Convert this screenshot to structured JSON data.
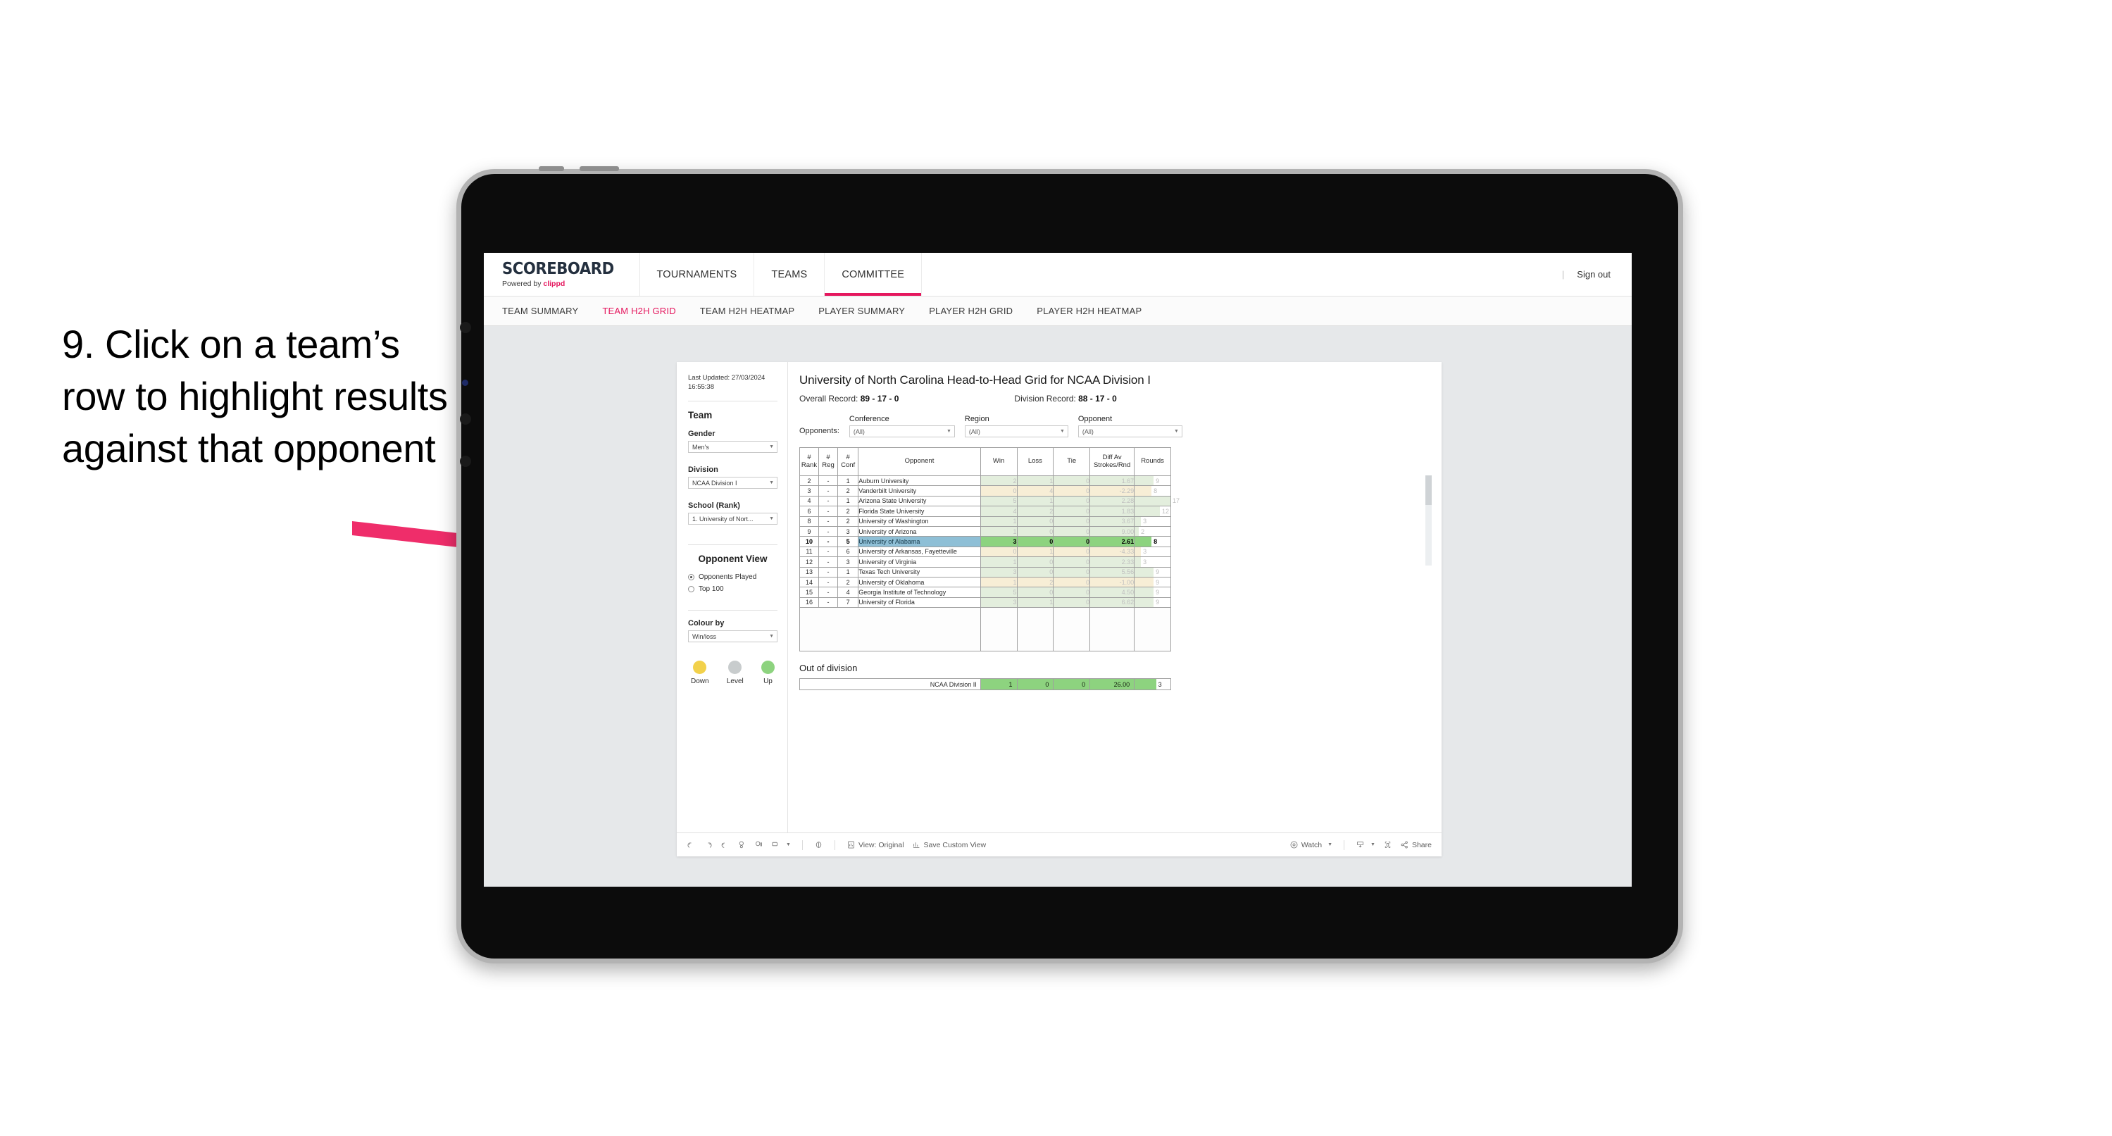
{
  "instruction": {
    "text": "9. Click on a team’s row to highlight results against that opponent"
  },
  "app": {
    "logo_main": "SCOREBOARD",
    "logo_sub_prefix": "Powered by ",
    "logo_sub_brand": "clippd",
    "top_nav": [
      {
        "label": "TOURNAMENTS",
        "active": false
      },
      {
        "label": "TEAMS",
        "active": false
      },
      {
        "label": "COMMITTEE",
        "active": true
      }
    ],
    "sign_out": "Sign out",
    "divider": "|",
    "sub_nav": [
      {
        "label": "TEAM SUMMARY",
        "active": false
      },
      {
        "label": "TEAM H2H GRID",
        "active": true
      },
      {
        "label": "TEAM H2H HEATMAP",
        "active": false
      },
      {
        "label": "PLAYER SUMMARY",
        "active": false
      },
      {
        "label": "PLAYER H2H GRID",
        "active": false
      },
      {
        "label": "PLAYER H2H HEATMAP",
        "active": false
      }
    ]
  },
  "sidebar": {
    "last_updated": "Last Updated: 27/03/2024 16:55:38",
    "team_heading": "Team",
    "gender_label": "Gender",
    "gender_value": "Men’s",
    "division_label": "Division",
    "division_value": "NCAA Division I",
    "school_label": "School (Rank)",
    "school_value": "1. University of Nort...",
    "opponent_view_heading": "Opponent View",
    "opponent_view_options": [
      {
        "label": "Opponents Played",
        "selected": true
      },
      {
        "label": "Top 100",
        "selected": false
      }
    ],
    "colour_by_label": "Colour by",
    "colour_by_value": "Win/loss",
    "legend": [
      {
        "caption": "Down",
        "color": "#f2d14b"
      },
      {
        "caption": "Level",
        "color": "#c8cccd"
      },
      {
        "caption": "Up",
        "color": "#8dd37f"
      }
    ]
  },
  "view": {
    "title": "University of North Carolina Head-to-Head Grid for NCAA Division I",
    "overall_record_label": "Overall Record: ",
    "overall_record_value": "89 - 17 - 0",
    "division_record_label": "Division Record: ",
    "division_record_value": "88 - 17 - 0",
    "filters_lead": "Opponents:",
    "filters": [
      {
        "label": "Conference",
        "value": "(All)"
      },
      {
        "label": "Region",
        "value": "(All)"
      },
      {
        "label": "Opponent",
        "value": "(All)"
      }
    ]
  },
  "grid": {
    "headers": [
      "# Rank",
      "# Reg",
      "# Conf",
      "Opponent",
      "Win",
      "Loss",
      "Tie",
      "Diff Av Strokes/Rnd",
      "Rounds"
    ],
    "header_lines": {
      "rank": [
        "#",
        "Rank"
      ],
      "reg": [
        "#",
        "Reg"
      ],
      "conf": [
        "#",
        "Conf"
      ],
      "opponent": [
        "Opponent"
      ],
      "win": [
        "Win"
      ],
      "loss": [
        "Loss"
      ],
      "tie": [
        "Tie"
      ],
      "diff": [
        "Diff Av",
        "Strokes/Rnd"
      ],
      "rounds": [
        "Rounds"
      ]
    },
    "rows": [
      {
        "rank": "2",
        "reg": "-",
        "conf": "1",
        "opponent": "Auburn University",
        "win": "2",
        "loss": "1",
        "tie": "0",
        "diff": "1.67",
        "rounds": 9,
        "tone": "up",
        "highlight": false
      },
      {
        "rank": "3",
        "reg": "-",
        "conf": "2",
        "opponent": "Vanderbilt University",
        "win": "0",
        "loss": "4",
        "tie": "0",
        "diff": "-2.29",
        "rounds": 8,
        "tone": "down",
        "highlight": false
      },
      {
        "rank": "4",
        "reg": "-",
        "conf": "1",
        "opponent": "Arizona State University",
        "win": "5",
        "loss": "1",
        "tie": "0",
        "diff": "2.28",
        "rounds": 17,
        "tone": "up",
        "highlight": false
      },
      {
        "rank": "6",
        "reg": "-",
        "conf": "2",
        "opponent": "Florida State University",
        "win": "4",
        "loss": "2",
        "tie": "0",
        "diff": "1.83",
        "rounds": 12,
        "tone": "up",
        "highlight": false
      },
      {
        "rank": "8",
        "reg": "-",
        "conf": "2",
        "opponent": "University of Washington",
        "win": "1",
        "loss": "0",
        "tie": "0",
        "diff": "3.67",
        "rounds": 3,
        "tone": "up",
        "highlight": false
      },
      {
        "rank": "9",
        "reg": "-",
        "conf": "3",
        "opponent": "University of Arizona",
        "win": "1",
        "loss": "0",
        "tie": "0",
        "diff": "9.00",
        "rounds": 2,
        "tone": "up",
        "highlight": false
      },
      {
        "rank": "10",
        "reg": "-",
        "conf": "5",
        "opponent": "University of Alabama",
        "win": "3",
        "loss": "0",
        "tie": "0",
        "diff": "2.61",
        "rounds": 8,
        "tone": "up",
        "highlight": true
      },
      {
        "rank": "11",
        "reg": "-",
        "conf": "6",
        "opponent": "University of Arkansas, Fayetteville",
        "win": "0",
        "loss": "1",
        "tie": "0",
        "diff": "-4.33",
        "rounds": 3,
        "tone": "down",
        "highlight": false
      },
      {
        "rank": "12",
        "reg": "-",
        "conf": "3",
        "opponent": "University of Virginia",
        "win": "1",
        "loss": "0",
        "tie": "0",
        "diff": "2.33",
        "rounds": 3,
        "tone": "up",
        "highlight": false
      },
      {
        "rank": "13",
        "reg": "-",
        "conf": "1",
        "opponent": "Texas Tech University",
        "win": "3",
        "loss": "0",
        "tie": "0",
        "diff": "5.56",
        "rounds": 9,
        "tone": "up",
        "highlight": false
      },
      {
        "rank": "14",
        "reg": "-",
        "conf": "2",
        "opponent": "University of Oklahoma",
        "win": "1",
        "loss": "2",
        "tie": "0",
        "diff": "-1.00",
        "rounds": 9,
        "tone": "down",
        "highlight": false
      },
      {
        "rank": "15",
        "reg": "-",
        "conf": "4",
        "opponent": "Georgia Institute of Technology",
        "win": "5",
        "loss": "0",
        "tie": "0",
        "diff": "4.50",
        "rounds": 9,
        "tone": "up",
        "highlight": false
      },
      {
        "rank": "16",
        "reg": "-",
        "conf": "7",
        "opponent": "University of Florida",
        "win": "3",
        "loss": "1",
        "tie": "0",
        "diff": "6.62",
        "rounds": 9,
        "tone": "up",
        "highlight": false
      }
    ],
    "rounds_max": 17,
    "colors": {
      "up_dim": "#e3eedd",
      "down_dim": "#f7eed6",
      "up_strong": "#8dd37f",
      "highlight_opponent": "#8ebfd6"
    }
  },
  "out_of_division": {
    "title": "Out of division",
    "row": {
      "label": "NCAA Division II",
      "win": "1",
      "loss": "0",
      "tie": "0",
      "diff": "26.00",
      "rounds": "3"
    }
  },
  "toolbar": {
    "view_label": "View: Original",
    "save_label": "Save Custom View",
    "watch_label": "Watch",
    "share_label": "Share"
  }
}
